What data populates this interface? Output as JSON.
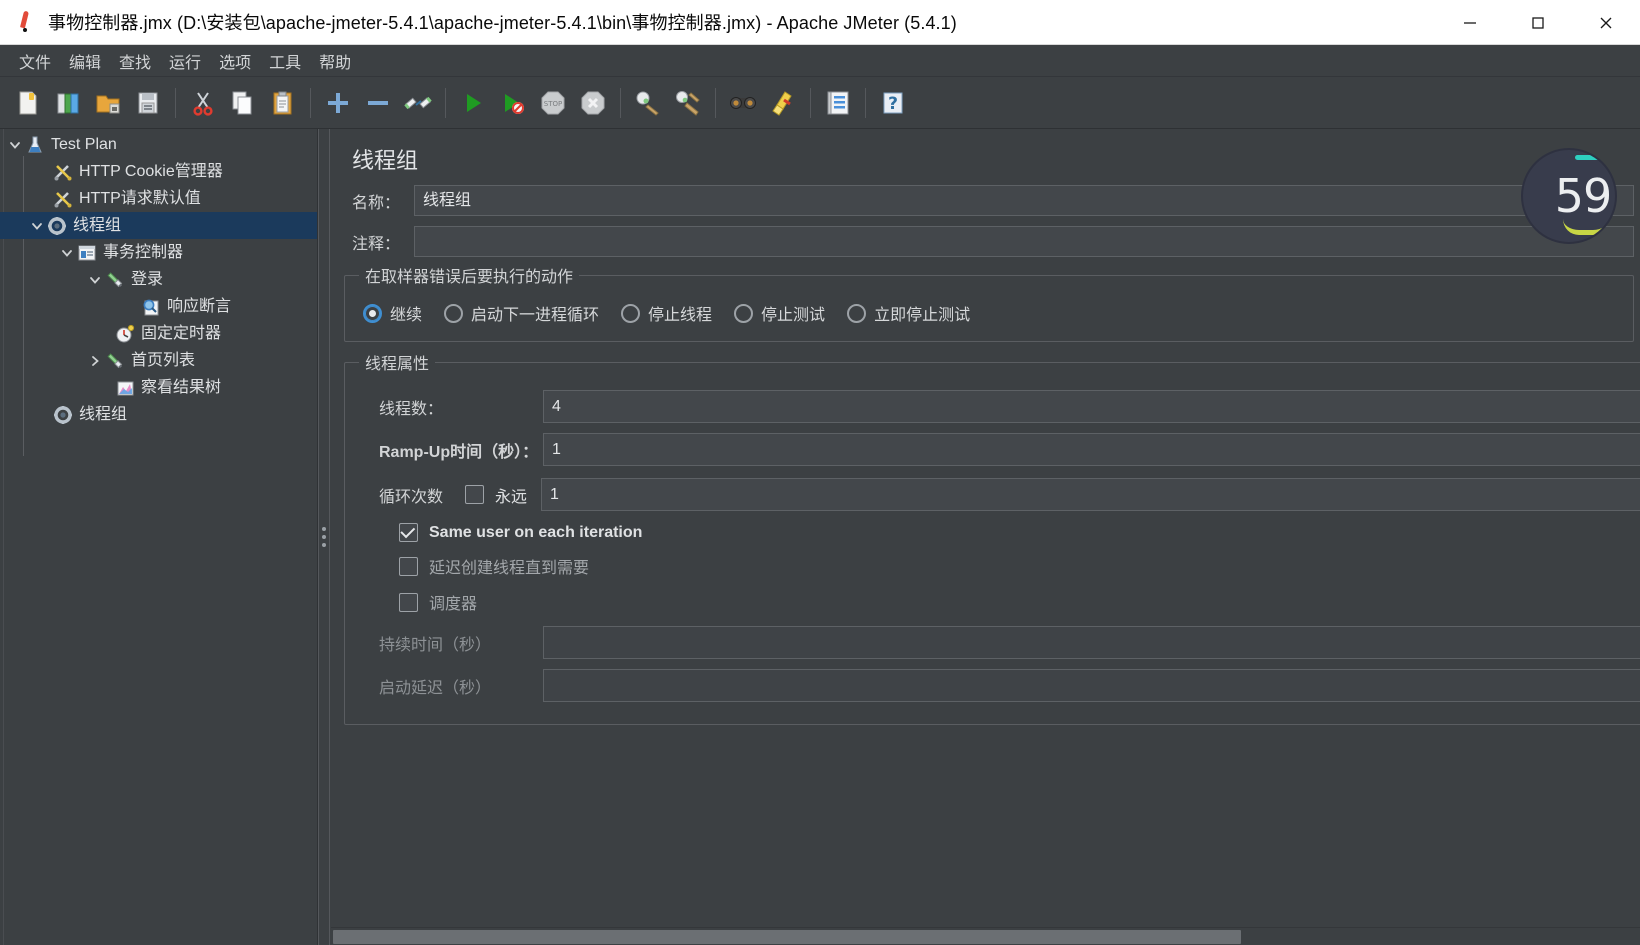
{
  "window": {
    "title": "事物控制器.jmx (D:\\安装包\\apache-jmeter-5.4.1\\apache-jmeter-5.4.1\\bin\\事物控制器.jmx) - Apache JMeter (5.4.1)",
    "app_icon": "jmeter-feather-icon",
    "controls": {
      "minimize": "minimize-icon",
      "maximize": "maximize-icon",
      "close": "close-icon"
    }
  },
  "menubar": {
    "items": [
      {
        "label": "文件"
      },
      {
        "label": "编辑"
      },
      {
        "label": "查找"
      },
      {
        "label": "运行"
      },
      {
        "label": "选项"
      },
      {
        "label": "工具"
      },
      {
        "label": "帮助"
      }
    ]
  },
  "toolbar": {
    "buttons": [
      {
        "name": "new-icon",
        "title": "新建"
      },
      {
        "name": "templates-icon",
        "title": "模板"
      },
      {
        "name": "open-icon",
        "title": "打开"
      },
      {
        "name": "save-icon",
        "title": "保存"
      },
      {
        "name": "cut-icon",
        "title": "剪切"
      },
      {
        "name": "copy-icon",
        "title": "复制"
      },
      {
        "name": "paste-icon",
        "title": "粘贴"
      },
      {
        "name": "expand-all-icon",
        "title": "展开全部"
      },
      {
        "name": "collapse-all-icon",
        "title": "折叠全部"
      },
      {
        "name": "toggle-icon",
        "title": "启用/禁用"
      },
      {
        "name": "start-icon",
        "title": "启动"
      },
      {
        "name": "start-no-pause-icon",
        "title": "无间断启动"
      },
      {
        "name": "stop-icon",
        "title": "停止"
      },
      {
        "name": "shutdown-icon",
        "title": "关闭"
      },
      {
        "name": "clear-icon",
        "title": "清除"
      },
      {
        "name": "clear-all-icon",
        "title": "清除全部"
      },
      {
        "name": "search-icon",
        "title": "查找"
      },
      {
        "name": "reset-search-icon",
        "title": "重置查找"
      },
      {
        "name": "function-helper-icon",
        "title": "函数助手对话框"
      },
      {
        "name": "help-icon",
        "title": "帮助"
      }
    ],
    "separators_after": [
      3,
      6,
      9,
      13,
      15,
      17,
      18
    ]
  },
  "tree": {
    "nodes": [
      {
        "label": "Test Plan",
        "icon": "test-plan-icon",
        "depth": 0,
        "twist": "down",
        "selected": false
      },
      {
        "label": "HTTP Cookie管理器",
        "icon": "config-element-icon",
        "depth": 1,
        "twist": "none",
        "selected": false
      },
      {
        "label": "HTTP请求默认值",
        "icon": "config-element-icon",
        "depth": 1,
        "twist": "none",
        "selected": false
      },
      {
        "label": "线程组",
        "icon": "thread-group-icon",
        "depth": 1,
        "twist": "down",
        "selected": true
      },
      {
        "label": "事务控制器",
        "icon": "transaction-controller-icon",
        "depth": 2,
        "twist": "down",
        "selected": false
      },
      {
        "label": "登录",
        "icon": "http-sampler-icon",
        "depth": 3,
        "twist": "down",
        "selected": false
      },
      {
        "label": "响应断言",
        "icon": "assertion-icon",
        "depth": 4,
        "twist": "none",
        "selected": false
      },
      {
        "label": "固定定时器",
        "icon": "timer-icon",
        "depth": 3,
        "twist": "none",
        "selected": false
      },
      {
        "label": "首页列表",
        "icon": "http-sampler-icon",
        "depth": 3,
        "twist": "right",
        "selected": false
      },
      {
        "label": "察看结果树",
        "icon": "view-results-tree-icon",
        "depth": 3,
        "twist": "none",
        "selected": false
      },
      {
        "label": "线程组",
        "icon": "thread-group-icon",
        "depth": 1,
        "twist": "none",
        "selected": false
      }
    ]
  },
  "editor": {
    "panel_title": "线程组",
    "name_label": "名称：",
    "name_value": "线程组",
    "comment_label": "注释：",
    "comment_value": "",
    "error_action": {
      "legend": "在取样器错误后要执行的动作",
      "options": [
        {
          "label": "继续",
          "selected": true
        },
        {
          "label": "启动下一进程循环",
          "selected": false
        },
        {
          "label": "停止线程",
          "selected": false
        },
        {
          "label": "停止测试",
          "selected": false
        },
        {
          "label": "立即停止测试",
          "selected": false
        }
      ]
    },
    "thread_properties": {
      "legend": "线程属性",
      "num_threads_label": "线程数：",
      "num_threads_value": "4",
      "ramp_up_label": "Ramp-Up时间（秒）：",
      "ramp_up_value": "1",
      "loop_count_label": "循环次数",
      "loop_forever_label": "永远",
      "loop_forever_checked": false,
      "loop_count_value": "1",
      "same_user_label": "Same user on each iteration",
      "same_user_checked": true,
      "delayed_start_label": "延迟创建线程直到需要",
      "delayed_start_checked": false,
      "scheduler_label": "调度器",
      "scheduler_checked": false,
      "duration_label": "持续时间（秒）",
      "duration_value": "",
      "startup_delay_label": "启动延迟（秒）",
      "startup_delay_value": ""
    }
  },
  "overlay": {
    "recorder_counter": "59"
  },
  "colors": {
    "window_bg": "#3c4043",
    "titlebar_bg": "#ffffff",
    "selection_bg": "#1b3a5c",
    "field_bg": "#43474b",
    "field_border": "#5d6165",
    "text": "#d6d8da",
    "accent_blue": "#3f8fd2"
  }
}
